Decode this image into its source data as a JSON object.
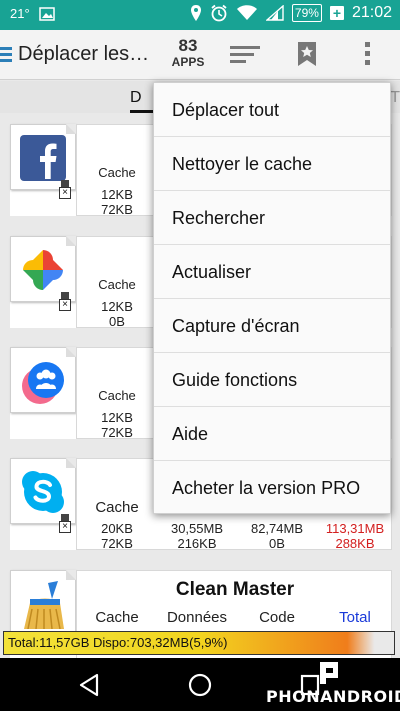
{
  "status_bar": {
    "temperature": "21°",
    "battery": "79%",
    "time": "21:02"
  },
  "action_bar": {
    "title": "Déplacer les…",
    "apps_count": "83",
    "apps_label": "APPS"
  },
  "tabs": {
    "active_fragment": "D",
    "right_fragment": "RT"
  },
  "apps": [
    {
      "name": "Facebook",
      "icon": "facebook-icon",
      "cache_label": "Cache",
      "cache_values": [
        "12KB",
        "72KB"
      ]
    },
    {
      "name": "Google Photos",
      "icon": "photos-icon",
      "cache_label": "Cache",
      "cache_values": [
        "12KB",
        "0B"
      ]
    },
    {
      "name": "Groups",
      "icon": "groups-icon",
      "cache_label": "Cache",
      "cache_values": [
        "12KB",
        "72KB"
      ]
    },
    {
      "name": "Skype",
      "icon": "skype-icon",
      "cache_label": "Cache",
      "row1": [
        "20KB",
        "30,55MB",
        "82,74MB",
        "113,31MB"
      ],
      "row2": [
        "72KB",
        "216KB",
        "0B",
        "288KB"
      ]
    },
    {
      "name": "Clean Master",
      "icon": "broom-icon",
      "headers": [
        "Cache",
        "Données",
        "Code",
        "Total"
      ]
    }
  ],
  "menu": {
    "items": [
      "Déplacer tout",
      "Nettoyer le cache",
      "Rechercher",
      "Actualiser",
      "Capture d'écran",
      "Guide fonctions",
      "Aide",
      "Acheter la version PRO"
    ]
  },
  "storage": {
    "text": "Total:11,57GB    Dispo:703,32MB(5,9%)",
    "used_fraction": 0.941
  },
  "watermark": {
    "text": "PHONANDROID"
  },
  "colors": {
    "status_bar": "#18a394",
    "total_red": "#d32020",
    "total_header_blue": "#1a3ad9"
  }
}
